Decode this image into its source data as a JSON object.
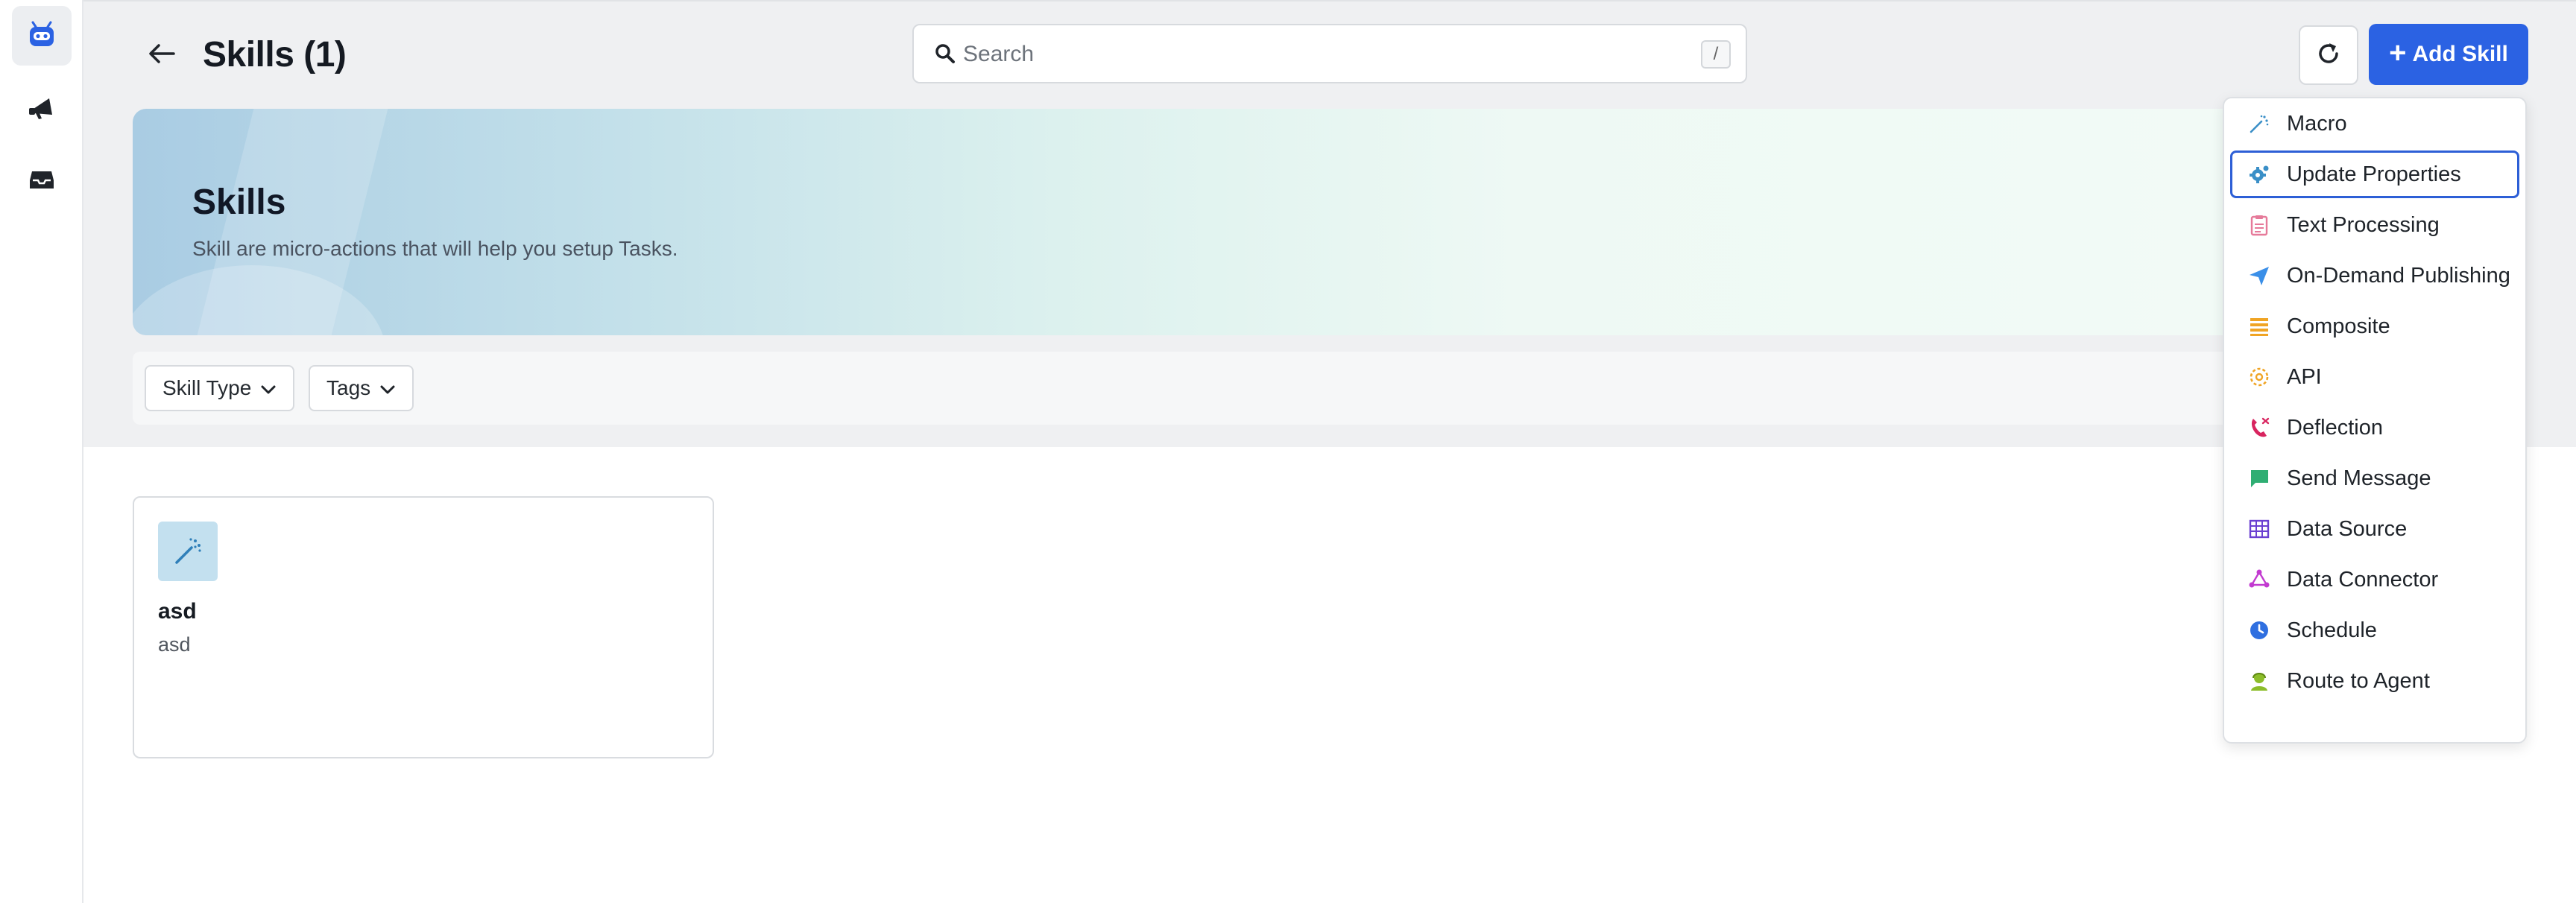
{
  "header": {
    "title": "Skills (1)",
    "search_placeholder": "Search",
    "search_shortcut": "/",
    "add_label": "Add Skill"
  },
  "banner": {
    "title": "Skills",
    "subtitle": "Skill are micro-actions that will help you setup Tasks."
  },
  "filters": [
    {
      "label": "Skill Type"
    },
    {
      "label": "Tags"
    }
  ],
  "skills": [
    {
      "name": "asd",
      "description": "asd",
      "icon": "magic-wand-icon"
    }
  ],
  "add_menu": {
    "selected": "Update Properties",
    "items": [
      {
        "label": "Macro",
        "icon": "magic-wand-icon",
        "color": "#3a8fc7"
      },
      {
        "label": "Update Properties",
        "icon": "gear-icon",
        "color": "#3a8fc7"
      },
      {
        "label": "Text Processing",
        "icon": "clipboard-icon",
        "color": "#e67a9a"
      },
      {
        "label": "On-Demand Publishing",
        "icon": "paper-plane-icon",
        "color": "#3a8fe8"
      },
      {
        "label": "Composite",
        "icon": "stack-icon",
        "color": "#f0a424"
      },
      {
        "label": "API",
        "icon": "api-icon",
        "color": "#f0a424"
      },
      {
        "label": "Deflection",
        "icon": "phone-icon",
        "color": "#d8245f"
      },
      {
        "label": "Send Message",
        "icon": "chat-icon",
        "color": "#2fae73"
      },
      {
        "label": "Data Source",
        "icon": "grid-icon",
        "color": "#6a3fd1"
      },
      {
        "label": "Data Connector",
        "icon": "connector-icon",
        "color": "#c23ad0"
      },
      {
        "label": "Schedule",
        "icon": "clock-icon",
        "color": "#2f6fe0"
      },
      {
        "label": "Route to Agent",
        "icon": "agent-icon",
        "color": "#8cbd2a"
      }
    ]
  },
  "colors": {
    "accent": "#2b62e3",
    "banner_start": "#a9cce3",
    "banner_end": "#f3fbf7"
  },
  "sidebar": {
    "items": [
      {
        "icon": "bot-icon",
        "active": true
      },
      {
        "icon": "megaphone-icon",
        "active": false
      },
      {
        "icon": "inbox-icon",
        "active": false
      }
    ]
  }
}
